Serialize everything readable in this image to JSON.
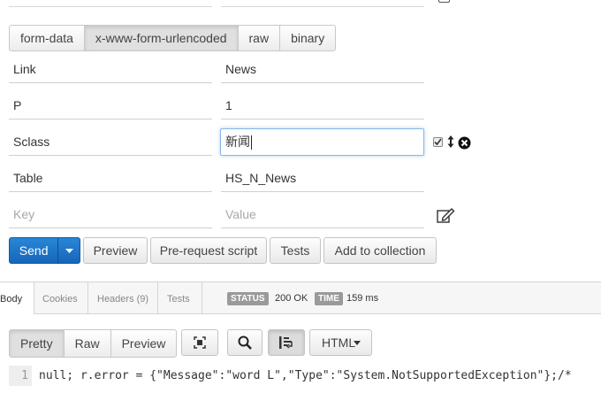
{
  "body_types": {
    "tabs": [
      "form-data",
      "x-www-form-urlencoded",
      "raw",
      "binary"
    ],
    "active": "x-www-form-urlencoded"
  },
  "params": [
    {
      "key": "Link",
      "value": "News"
    },
    {
      "key": "P",
      "value": "1"
    },
    {
      "key": "Sclass",
      "value": "新闻"
    },
    {
      "key": "Table",
      "value": "HS_N_News"
    }
  ],
  "new_param": {
    "key_placeholder": "Key",
    "value_placeholder": "Value"
  },
  "actions": {
    "send": "Send",
    "preview": "Preview",
    "prerequest": "Pre-request script",
    "tests": "Tests",
    "add_collection": "Add to collection"
  },
  "response_tabs": [
    "Body",
    "Cookies",
    "Headers (9)",
    "Tests"
  ],
  "status": {
    "label": "STATUS",
    "value": "200 OK"
  },
  "time": {
    "label": "TIME",
    "value": "159 ms"
  },
  "view_modes": [
    "Pretty",
    "Raw",
    "Preview"
  ],
  "active_view": "Pretty",
  "format": "HTML",
  "icons": [
    "checkbox-icon",
    "drag-handle-icon",
    "remove-icon",
    "bulk-edit-icon",
    "caret-down-icon",
    "fullscreen-icon",
    "search-icon",
    "wrap-lines-icon"
  ],
  "code": {
    "line_number": "1",
    "text": "null; r.error = {\"Message\":\"word L\",\"Type\":\"System.NotSupportedException\"};/*"
  },
  "colors": {
    "send": "#1a72c6",
    "badge": "#9a9a9a",
    "focus": "#88b8e6"
  }
}
